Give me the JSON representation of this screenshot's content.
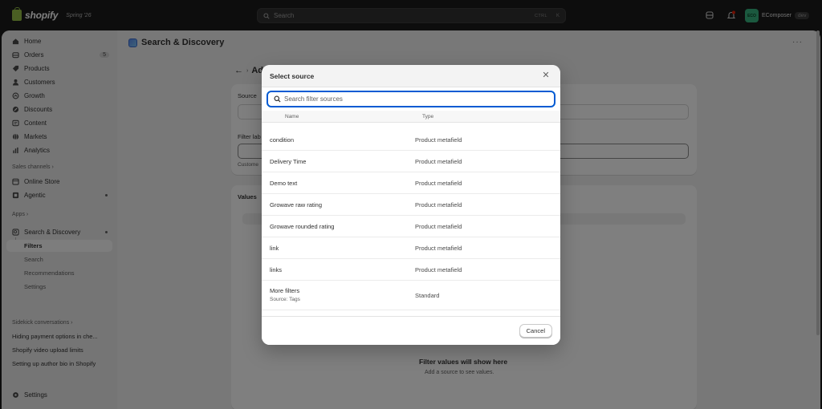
{
  "topbar": {
    "logo_text": "shopify",
    "edition": "Spring '26",
    "search_placeholder": "Search",
    "shortcut_ctrl": "CTRL",
    "shortcut_key": "K",
    "store_initials": "ECO",
    "store_name": "EComposer",
    "store_badge": "dev"
  },
  "sidebar": {
    "items": [
      {
        "label": "Home",
        "icon": "home-icon"
      },
      {
        "label": "Orders",
        "icon": "orders-icon",
        "count": "5"
      },
      {
        "label": "Products",
        "icon": "tag-icon"
      },
      {
        "label": "Customers",
        "icon": "person-icon"
      },
      {
        "label": "Growth",
        "icon": "growth-icon"
      },
      {
        "label": "Discounts",
        "icon": "discount-icon"
      },
      {
        "label": "Content",
        "icon": "content-icon"
      },
      {
        "label": "Markets",
        "icon": "globe-icon"
      },
      {
        "label": "Analytics",
        "icon": "chart-icon"
      }
    ],
    "sales_channels_label": "Sales channels",
    "channels": [
      {
        "label": "Online Store",
        "icon": "store-icon"
      },
      {
        "label": "Agentic",
        "icon": "agentic-icon"
      }
    ],
    "apps_label": "Apps",
    "app": {
      "label": "Search & Discovery",
      "icon": "search-discovery-icon"
    },
    "app_sub": [
      "Filters",
      "Search",
      "Recommendations",
      "Settings"
    ],
    "sidekick_label": "Sidekick conversations",
    "conversations": [
      "Hiding payment options in che...",
      "Shopify video upload limits",
      "Setting up author bio in Shopify"
    ],
    "settings_label": "Settings"
  },
  "page": {
    "title": "Search & Discovery",
    "back_title": "Ad",
    "source_label": "Source",
    "filter_label": "Filter lab",
    "custom_hint": "Custome",
    "values_label": "Values",
    "empty_title": "Filter values will show here",
    "empty_sub": "Add a source to see values."
  },
  "modal": {
    "title": "Select source",
    "search_placeholder": "Search filter sources",
    "col_name": "Name",
    "col_type": "Type",
    "rows": [
      {
        "name": "condition",
        "type": "Product metafield"
      },
      {
        "name": "Delivery Time",
        "type": "Product metafield"
      },
      {
        "name": "Demo text",
        "type": "Product metafield"
      },
      {
        "name": "Growave raw rating",
        "type": "Product metafield"
      },
      {
        "name": "Growave rounded rating",
        "type": "Product metafield"
      },
      {
        "name": "link",
        "type": "Product metafield"
      },
      {
        "name": "links",
        "type": "Product metafield"
      },
      {
        "name": "More filters",
        "sub": "Source: Tags",
        "type": "Standard"
      }
    ],
    "cancel_label": "Cancel"
  }
}
